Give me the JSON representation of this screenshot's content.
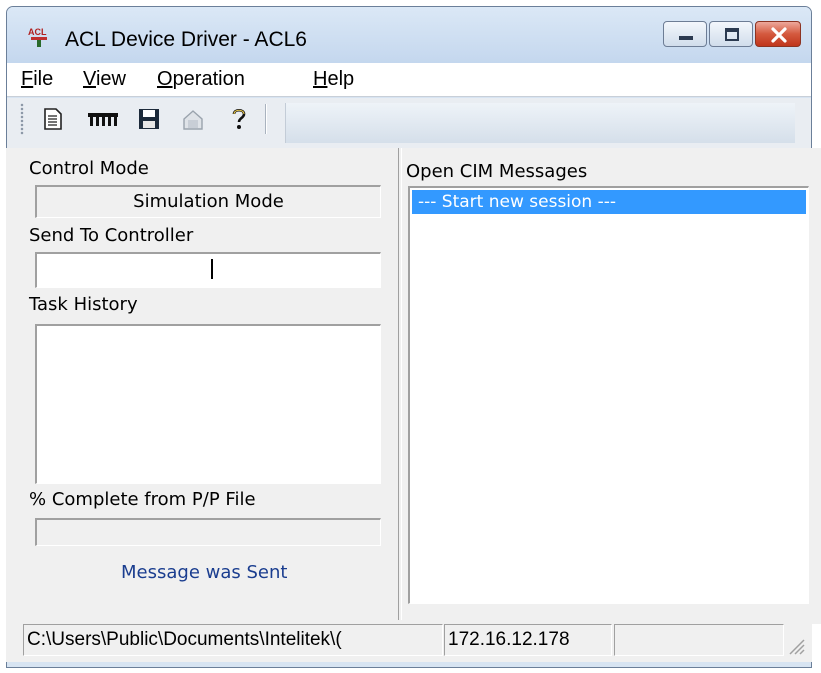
{
  "window": {
    "title": "ACL Device Driver - ACL6",
    "icon": "acl-app-icon",
    "controls": [
      "minimize",
      "maximize",
      "close"
    ]
  },
  "menu": [
    {
      "label": "File",
      "mnemonic": "F",
      "rest": "ile"
    },
    {
      "label": "View",
      "mnemonic": "V",
      "rest": "iew"
    },
    {
      "label": "Operation",
      "mnemonic": "O",
      "rest": "peration"
    },
    {
      "label": "Help",
      "mnemonic": "H",
      "rest": "elp"
    }
  ],
  "toolbar": {
    "buttons": [
      "new-document-icon",
      "controller-icon",
      "save-icon",
      "load-icon",
      "help-icon"
    ]
  },
  "left_panel": {
    "control_mode_label": "Control Mode",
    "control_mode_value": "Simulation Mode",
    "send_label": "Send To Controller",
    "send_value": "",
    "task_history_label": "Task History",
    "progress_label": "% Complete from P/P File",
    "progress_value": 0,
    "status_message": "Message was Sent"
  },
  "right_panel": {
    "label": "Open CIM Messages",
    "messages": [
      "--- Start new session ---"
    ]
  },
  "statusbar": {
    "path": "C:\\Users\\Public\\Documents\\Intelitek\\(",
    "ip": "172.16.12.178",
    "extra": ""
  },
  "colors": {
    "selection": "#3399ff",
    "status_message": "#1a3d8f"
  }
}
